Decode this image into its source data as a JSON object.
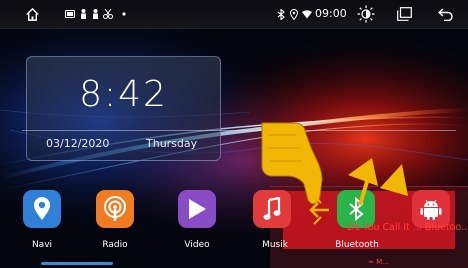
{
  "status_bar": {
    "home_icon": "home-icon",
    "notification_icons": [
      "cast-icon",
      "person-icon",
      "person-icon",
      "scissors-icon",
      "dot-icon"
    ],
    "bluetooth_icon": "bluetooth-icon",
    "location_icon": "location-icon",
    "wifi_icon": "wifi-icon",
    "time": "09:00",
    "brightness_icon": "brightness-icon",
    "recents_icon": "recents-icon",
    "back_icon": "back-icon"
  },
  "clock_widget": {
    "time": "8:42",
    "date": "03/12/2020",
    "day": "Thursday"
  },
  "dock": [
    {
      "label": "Navi",
      "icon": "location-pin-icon",
      "color": "#2f80d6"
    },
    {
      "label": "Radio",
      "icon": "radio-icon",
      "color": "#f07c22"
    },
    {
      "label": "Video",
      "icon": "play-icon",
      "color": "#8a4cc4"
    },
    {
      "label": "Musik",
      "icon": "music-note-icon",
      "color": "#e23b3b"
    },
    {
      "label": "Bluetooth",
      "icon": "bluetooth-icon",
      "color": "#2bb44a"
    },
    {
      "label": "",
      "icon": "android-icon",
      "color": "#e0313b"
    }
  ],
  "bluetooth_prompt": {
    "text": "Do You Call It ... Bluetoo...",
    "text2": "≈ M..."
  },
  "tutorial_overlay": {
    "hand_icon": "pointing-hand-icon",
    "arrow_icons": [
      "arrow-up-icon",
      "arrow-up-icon"
    ],
    "move_icon": "move-arrows-icon"
  },
  "colors": {
    "accent_blue": "#2f8fd8",
    "overlay_red": "#c4161f",
    "hand_yellow": "#f2b705"
  }
}
